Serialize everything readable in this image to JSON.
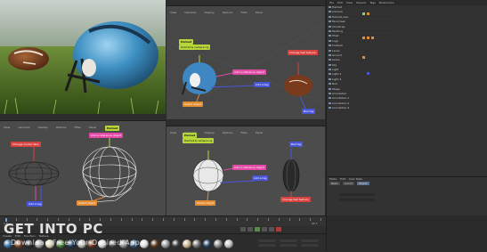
{
  "viewports": {
    "top_right": {
      "menu": [
        "View",
        "Cameras",
        "Display",
        "Options",
        "Filter",
        "Panel"
      ]
    },
    "bottom_left": {
      "menu": [
        "View",
        "Cameras",
        "Display",
        "Options",
        "Filter",
        "Panel"
      ]
    },
    "bottom_right": {
      "menu": [
        "View",
        "Cameras",
        "Display",
        "Options",
        "Filter",
        "Panel"
      ]
    }
  },
  "annotations": {
    "tr_title": "Helmet",
    "tr_helmet_note": "Helmet & camera rig",
    "tr_pink": "Add a reference object",
    "tr_blue": "Add a tag",
    "tr_orange": "Select object",
    "tr_red": "Change ball texture",
    "tr_ball_blue": "Ball tag",
    "bl_red": "Change model here",
    "bl_pink": "Add a reference object",
    "bl_blue": "Add a tag",
    "bl_orange": "Select object",
    "bl_title": "Helmet",
    "br_title": "Helmet",
    "br_helmet_note": "Helmet & camera rig",
    "br_pink": "Add a reference object",
    "br_blue": "Add a tag",
    "br_orange": "Select object",
    "br_ball_blue": "Ball tag",
    "br_red": "Change ball texture"
  },
  "object_manager": {
    "menu": [
      "File",
      "Edit",
      "View",
      "Objects",
      "Tags",
      "Bookmarks"
    ],
    "rows": [
      "Helmet",
      "Camera",
      "Helmet_Geo",
      "Facemask",
      "Chinstrap",
      "Padding",
      "Shell",
      "Logo",
      "Football",
      "Laces",
      "Ground",
      "Grass",
      "Sky",
      "Light",
      "Light.1",
      "Light.2",
      "Null",
      "Stage",
      "Annotation",
      "Annotation.1",
      "Annotation.2",
      "Annotation.3"
    ]
  },
  "attributes": {
    "menu": [
      "Mode",
      "Edit",
      "User Data"
    ],
    "tabs": [
      "Basic",
      "Coord",
      "Object"
    ]
  },
  "timeline": {
    "frame_start": "0 F",
    "frame_end": "90 F",
    "current_frame": "0 F"
  },
  "material_bar": {
    "menu": [
      "Create",
      "Edit",
      "Function",
      "Texture"
    ]
  },
  "watermark": {
    "title": "GET INTO PC",
    "subtitle": "Download Free Your Desired App"
  },
  "colors": {
    "lime": "#b7d63a",
    "pink": "#e24aa5",
    "red": "#d8433f",
    "blue": "#4a56d9",
    "orange": "#e48c32"
  }
}
